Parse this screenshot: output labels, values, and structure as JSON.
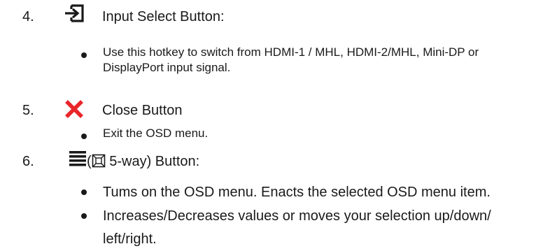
{
  "items": [
    {
      "number": "4.",
      "icon": "input-select-icon",
      "title": "Input Select Button:",
      "bullets": [
        {
          "lines": [
            "Use this hotkey to switch from HDMI-1 / MHL, HDMI-2/MHL, Mini-DP or",
            "DisplayPort input signal."
          ]
        }
      ]
    },
    {
      "number": "5.",
      "icon": "close-x-icon",
      "icon_color": "#e8262a",
      "title": "Close Button",
      "bullets": [
        {
          "lines": [
            "Exit the OSD menu."
          ]
        }
      ]
    },
    {
      "number": "6.",
      "icon": "menu-lines-icon",
      "open_paren": "(",
      "inline_icon": "five-way-icon",
      "title_rest": " 5-way) Button:",
      "bullets": [
        {
          "lines": [
            "Tums on the OSD menu. Enacts the selected OSD menu item."
          ]
        },
        {
          "lines": [
            "Increases/Decreases values or moves your selection up/down/",
            "left/right."
          ]
        }
      ]
    }
  ]
}
